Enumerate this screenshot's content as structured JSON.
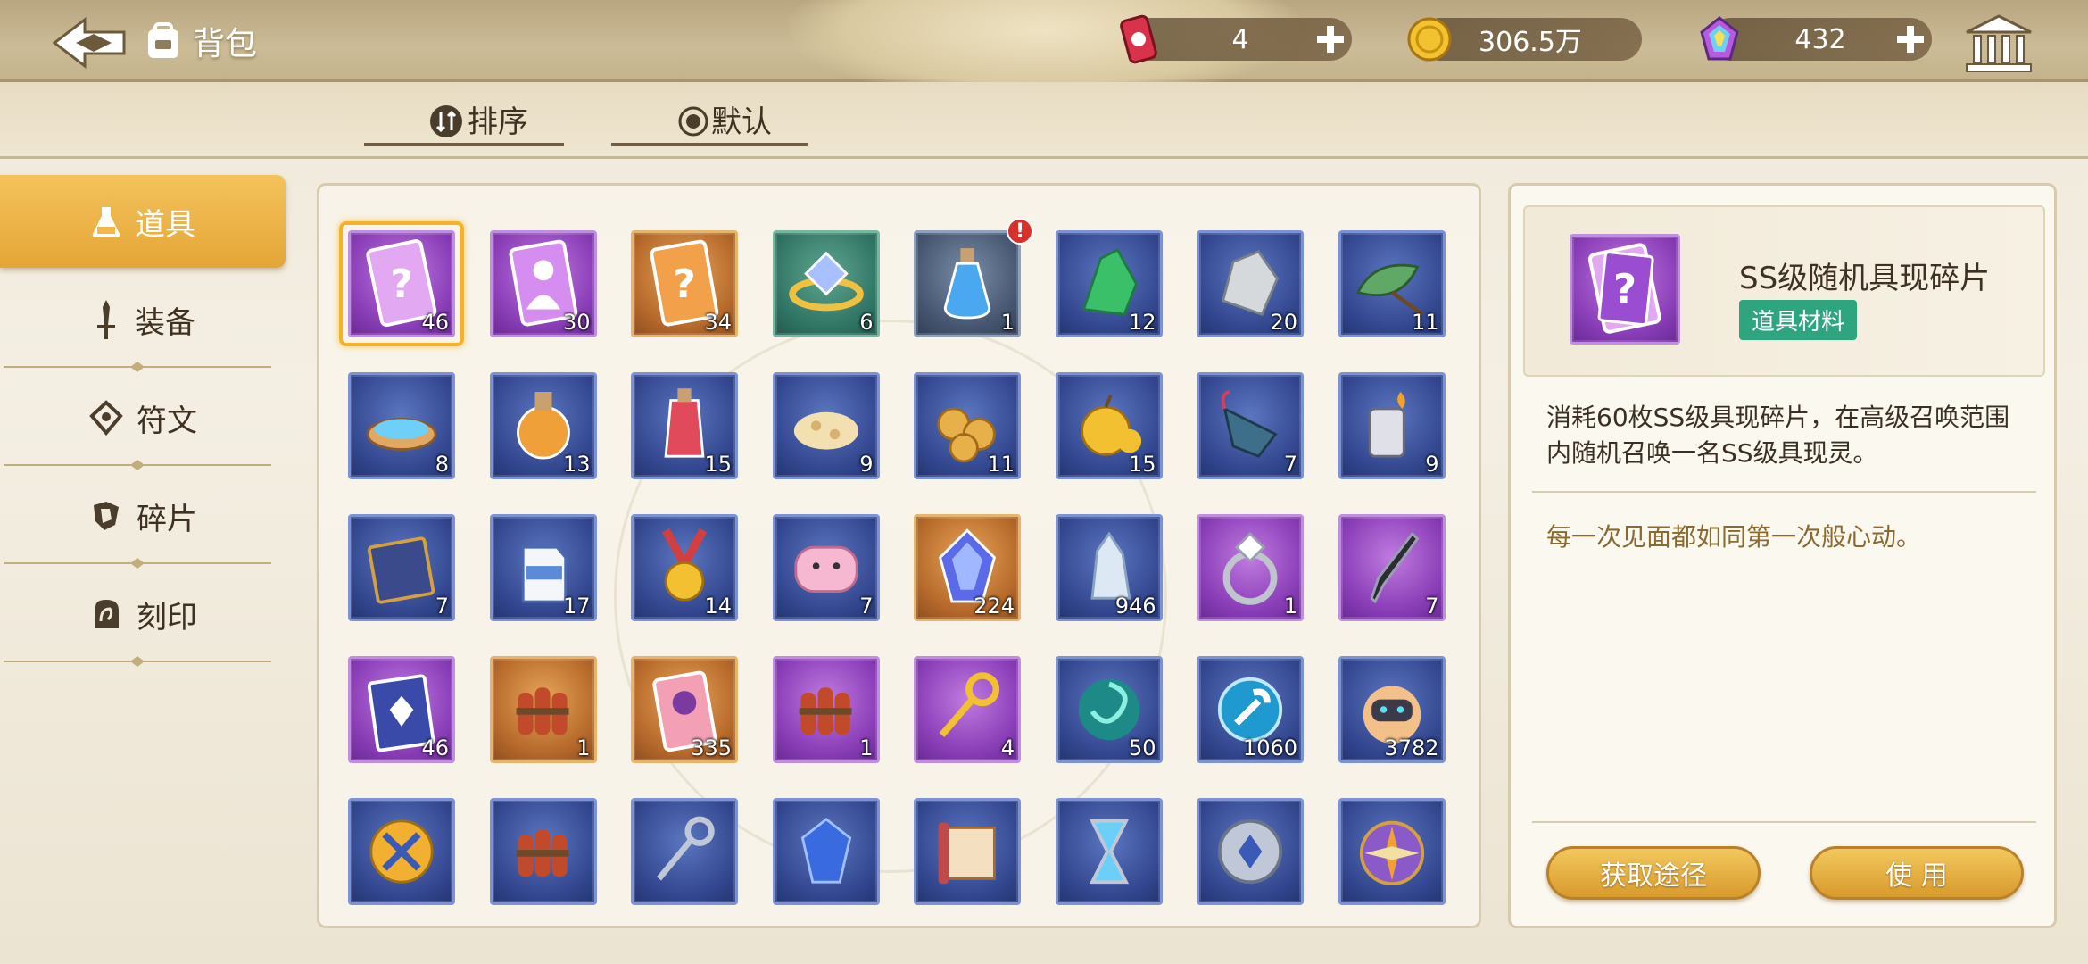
{
  "header": {
    "title": "背包",
    "resources": [
      {
        "name": "stamina-can",
        "value": "4",
        "has_plus": true
      },
      {
        "name": "gold-coin",
        "value": "306.5万",
        "has_plus": false
      },
      {
        "name": "rainbow-gem",
        "value": "432",
        "has_plus": true
      }
    ]
  },
  "sort_bar": {
    "sort_label": "排序",
    "default_label": "默认"
  },
  "sidebar": {
    "items": [
      {
        "label": "道具",
        "icon": "flask-icon",
        "active": true
      },
      {
        "label": "装备",
        "icon": "sword-icon",
        "active": false
      },
      {
        "label": "符文",
        "icon": "rune-icon",
        "active": false
      },
      {
        "label": "碎片",
        "icon": "shard-icon",
        "active": false
      },
      {
        "label": "刻印",
        "icon": "seal-icon",
        "active": false
      }
    ]
  },
  "grid": {
    "items": [
      {
        "icon": "ss-random-shard-icon",
        "count": "46",
        "rarity": "purple",
        "selected": true
      },
      {
        "icon": "silhouette-card-icon",
        "count": "30",
        "rarity": "purple"
      },
      {
        "icon": "mystery-card-icon",
        "count": "34",
        "rarity": "orange"
      },
      {
        "icon": "gem-ring-icon",
        "count": "6",
        "rarity": "green"
      },
      {
        "icon": "blue-potion-icon",
        "count": "1",
        "rarity": "gray",
        "alert": "!"
      },
      {
        "icon": "green-crystal-icon",
        "count": "12",
        "rarity": "blue"
      },
      {
        "icon": "white-stone-icon",
        "count": "20",
        "rarity": "blue"
      },
      {
        "icon": "leaf-icon",
        "count": "11",
        "rarity": "blue"
      },
      {
        "icon": "water-bowl-icon",
        "count": "8",
        "rarity": "blue"
      },
      {
        "icon": "orange-potion-icon",
        "count": "13",
        "rarity": "blue"
      },
      {
        "icon": "red-potion-icon",
        "count": "15",
        "rarity": "blue"
      },
      {
        "icon": "crumbs-icon",
        "count": "9",
        "rarity": "blue"
      },
      {
        "icon": "cookies-icon",
        "count": "11",
        "rarity": "blue"
      },
      {
        "icon": "golden-apple-icon",
        "count": "15",
        "rarity": "blue"
      },
      {
        "icon": "umbrella-icon",
        "count": "7",
        "rarity": "blue"
      },
      {
        "icon": "lighter-icon",
        "count": "9",
        "rarity": "blue"
      },
      {
        "icon": "book-icon",
        "count": "7",
        "rarity": "blue"
      },
      {
        "icon": "milk-icon",
        "count": "17",
        "rarity": "blue"
      },
      {
        "icon": "medal-icon",
        "count": "14",
        "rarity": "blue"
      },
      {
        "icon": "pillow-icon",
        "count": "7",
        "rarity": "blue"
      },
      {
        "icon": "blue-crystal-icon",
        "count": "224",
        "rarity": "orange"
      },
      {
        "icon": "ice-crystal-icon",
        "count": "946",
        "rarity": "blue"
      },
      {
        "icon": "diamond-ring-icon",
        "count": "1",
        "rarity": "purple"
      },
      {
        "icon": "dagger-icon",
        "count": "7",
        "rarity": "purple"
      },
      {
        "icon": "fashion-tag-icon",
        "count": "46",
        "rarity": "purple"
      },
      {
        "icon": "dynamite-icon",
        "count": "1",
        "rarity": "orange"
      },
      {
        "icon": "ticket-icon",
        "count": "335",
        "rarity": "orange"
      },
      {
        "icon": "dynamite-icon",
        "count": "1",
        "rarity": "purple"
      },
      {
        "icon": "golden-key-icon",
        "count": "4",
        "rarity": "purple"
      },
      {
        "icon": "teal-swirl-icon",
        "count": "50",
        "rarity": "blue"
      },
      {
        "icon": "wrench-coin-icon",
        "count": "1060",
        "rarity": "blue"
      },
      {
        "icon": "robot-pet-icon",
        "count": "3782",
        "rarity": "blue"
      },
      {
        "icon": "cross-coin-icon",
        "count": "",
        "rarity": "blue"
      },
      {
        "icon": "dynamite-icon",
        "count": "",
        "rarity": "blue"
      },
      {
        "icon": "silver-key-icon",
        "count": "",
        "rarity": "blue"
      },
      {
        "icon": "blue-gem-icon",
        "count": "",
        "rarity": "blue"
      },
      {
        "icon": "map-scroll-icon",
        "count": "",
        "rarity": "blue"
      },
      {
        "icon": "hourglass-icon",
        "count": "",
        "rarity": "blue"
      },
      {
        "icon": "silver-coin-icon",
        "count": "",
        "rarity": "blue"
      },
      {
        "icon": "compass-icon",
        "count": "",
        "rarity": "blue"
      }
    ]
  },
  "detail": {
    "name": "SS级随机具现碎片",
    "tag": "道具材料",
    "description": "消耗60枚SS级具现碎片，在高级召唤范围内随机召唤一名SS级具现灵。",
    "flavor": "每一次见面都如同第一次般心动。",
    "obtain_label": "获取途径",
    "use_label": "使 用"
  },
  "colors": {
    "accent_gold": "#e4a636",
    "tag_green": "#2fa57f",
    "alert_red": "#d9302a"
  }
}
